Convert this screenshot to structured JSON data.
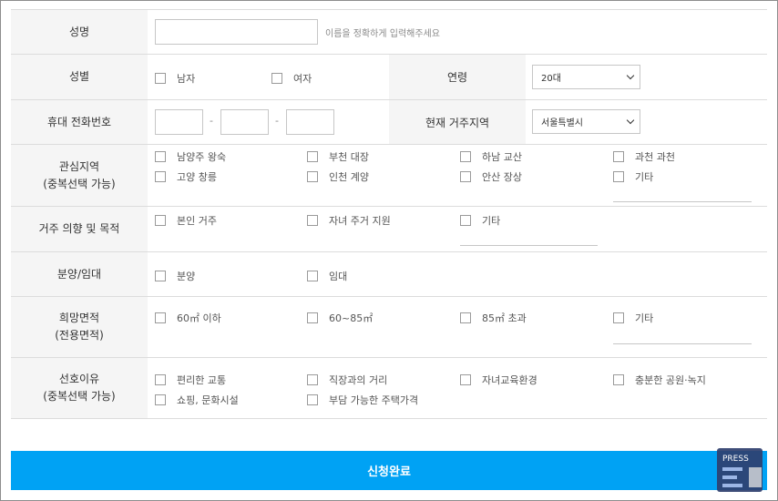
{
  "fields": {
    "name": {
      "label": "성명",
      "hint": "이름을 정확하게 입력해주세요",
      "value": ""
    },
    "gender": {
      "label": "성별",
      "options": [
        "남자",
        "여자"
      ]
    },
    "age": {
      "label": "연령",
      "selected": "20대"
    },
    "phone": {
      "label": "휴대 전화번호",
      "separator": "-"
    },
    "residence": {
      "label": "현재 거주지역",
      "selected": "서울특별시"
    },
    "interest_region": {
      "label_line1": "관심지역",
      "label_line2": "(중복선택 가능)",
      "options": [
        "남양주 왕숙",
        "부천 대장",
        "하남 교산",
        "과천 과천",
        "고양 창릉",
        "인천 계양",
        "안산 장상",
        "기타"
      ]
    },
    "purpose": {
      "label": "거주 의향 및 목적",
      "options": [
        "본인 거주",
        "자녀 주거 지원",
        "기타"
      ]
    },
    "sale_lease": {
      "label": "분양/임대",
      "options": [
        "분양",
        "임대"
      ]
    },
    "area": {
      "label_line1": "희망면적",
      "label_line2": "(전용면적)",
      "options": [
        "60㎡ 이하",
        "60~85㎡",
        "85㎡ 초과",
        "기타"
      ]
    },
    "reason": {
      "label_line1": "선호이유",
      "label_line2": "(중복선택 가능)",
      "options": [
        "편리한 교통",
        "직장과의 거리",
        "자녀교육환경",
        "충분한 공원·녹지",
        "쇼핑, 문화시설",
        "부담 가능한 주택가격"
      ]
    }
  },
  "submit_label": "신청완료",
  "badge_label": "PRESS",
  "colors": {
    "accent": "#00a2f4",
    "label_bg": "#f5f5f5",
    "border": "#dcdcdc"
  }
}
